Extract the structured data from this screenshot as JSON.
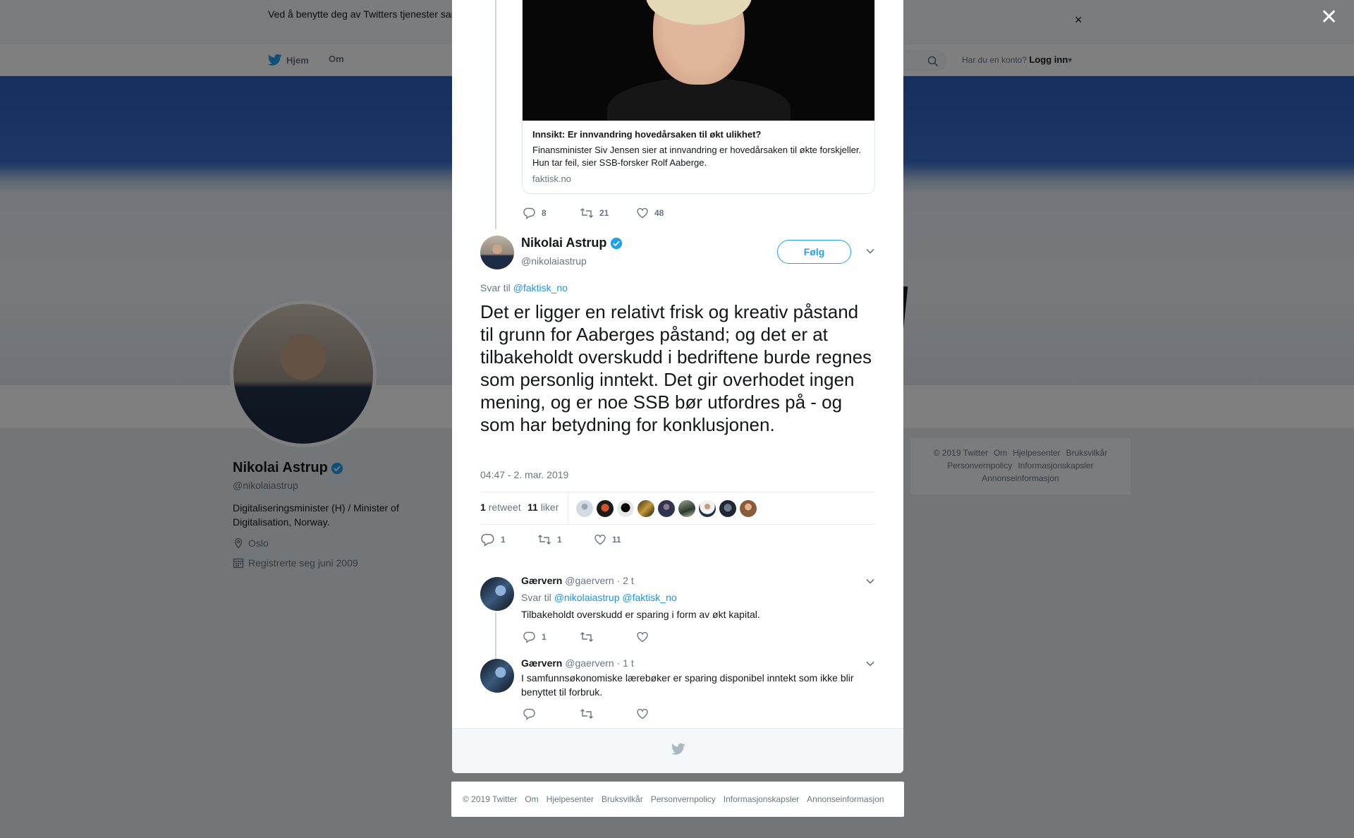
{
  "cookie_banner": {
    "text": "Ved å benytte deg av Twitters tjenester samtykker du i at vi bruker informasjonskapsler til bl.a. analyser, personalisering og annonser."
  },
  "nav": {
    "home": "Hjem",
    "about": "Om",
    "login_prompt": "Har du en konto?",
    "login": "Logg inn"
  },
  "profile": {
    "name": "Nikolai Astrup",
    "handle": "@nikolaiastrup",
    "bio": "Digitaliseringsminister (H) / Minister of Digitalisation, Norway.",
    "location": "Oslo",
    "joined": "Registrerte seg juni 2009"
  },
  "side_footer": [
    "© 2019 Twitter",
    "Om",
    "Hjelpesenter",
    "Bruksvilkår",
    "Personvernpolicy",
    "Informasjonskapsler",
    "Annonseinformasjon"
  ],
  "quoted": {
    "card_title": "Innsikt: Er innvandring hovedårsaken til økt ulikhet?",
    "card_desc": "Finansminister Siv Jensen sier at innvandring er hovedårsaken til økte forskjeller. Hun tar feil, sier SSB-forsker Rolf Aaberge.",
    "card_domain": "faktisk.no",
    "replies": "8",
    "retweets": "21",
    "likes": "48"
  },
  "tweet": {
    "name": "Nikolai Astrup",
    "handle": "@nikolaiastrup",
    "follow_label": "Følg",
    "reply_prefix": "Svar til",
    "reply_to": "@faktisk_no",
    "text": "Det er ligger en relativt frisk og kreativ påstand til grunn for Aaberges påstand; og det er at tilbakeholdt overskudd i bedriftene burde regnes som personlig inntekt. Det gir overhodet ingen mening, og er noe SSB bør utfordres på - og som har betydning for konklusjonen.",
    "timestamp": "04:47 - 2. mar. 2019",
    "retweet_count": "1",
    "retweet_label": "retweet",
    "like_count": "11",
    "like_label": "liker",
    "replies": "1",
    "retweets": "1",
    "likes": "11"
  },
  "replies": [
    {
      "name": "Gærvern",
      "handle": "@gaervern",
      "time": "· 2 t",
      "reply_prefix": "Svar til",
      "reply_to_1": "@nikolaiastrup",
      "reply_to_2": "@faktisk_no",
      "text": "Tilbakeholdt overskudd er sparing i form av økt kapital.",
      "replies": "1"
    },
    {
      "name": "Gærvern",
      "handle": "@gaervern",
      "time": "· 1 t",
      "text": "I samfunnsøkonomiske lærebøker er sparing disponibel inntekt som ikke blir benyttet til forbruk."
    }
  ],
  "bottom_footer": [
    "© 2019 Twitter",
    "Om",
    "Hjelpesenter",
    "Bruksvilkår",
    "Personvernpolicy",
    "Informasjonskapsler",
    "Annonseinformasjon"
  ],
  "colors": {
    "accent": "#1da1f2",
    "link": "#1b95e0",
    "muted": "#657786",
    "like_active": "#e0245e"
  }
}
